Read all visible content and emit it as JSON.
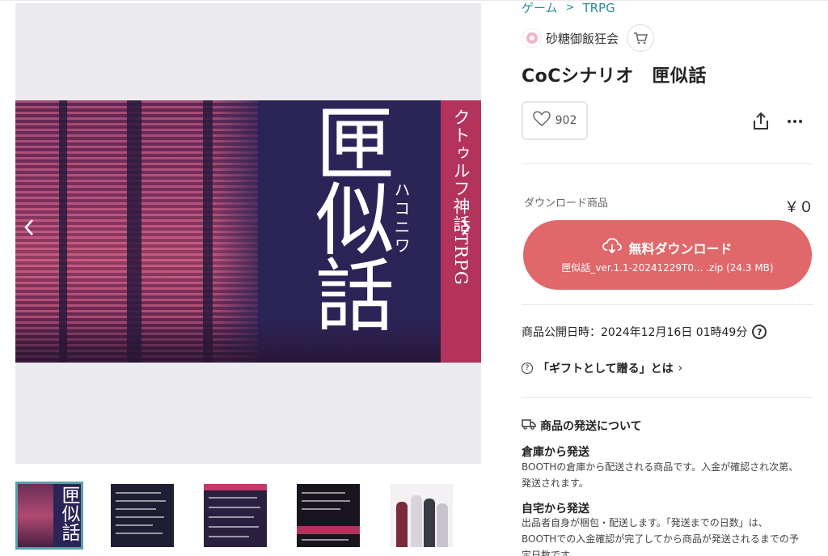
{
  "breadcrumb": {
    "items": [
      "ゲーム",
      "TRPG"
    ],
    "separator": ">"
  },
  "shop": {
    "name": "砂糖御飯狂会"
  },
  "product": {
    "title": "CoCシナリオ　匣似話",
    "likes": "902",
    "type_label": "ダウンロード商品",
    "price": "￥０"
  },
  "cover": {
    "band_text": "クトゥルフ神話TRPG",
    "title_text": "匣似話",
    "ruby_text": "ハコニワ"
  },
  "download": {
    "label": "無料ダウンロード",
    "file": "匣似話_ver.1.1-20241229T0... .zip (24.3 MB)"
  },
  "publish": {
    "text": "商品公開日時：2024年12月16日 01時49分",
    "help": "?"
  },
  "gift": {
    "label": "「ギフトとして贈る」とは",
    "chevron": "›",
    "icon": "?"
  },
  "shipping": {
    "heading": "商品の発送について",
    "warehouse_title": "倉庫から発送",
    "warehouse_body_1": "BOOTHの倉庫から配送される商品です。入金が確認され次第、",
    "warehouse_body_2": "発送されます。",
    "home_title": "自宅から発送",
    "home_body_1": "出品者自身が梱包・配送します。「発送までの日数」は、",
    "home_body_2": "BOOTHでの入金確認が完了してから商品が発送されるまでの予",
    "home_body_3": "定日数です。"
  },
  "thumbnails": {
    "first_text": "匣似話"
  },
  "colors": {
    "accent": "#e0676a",
    "link": "#2a8aa0",
    "cover_band": "#b3335c",
    "cover_dark": "#2b2456"
  },
  "icons": [
    "cart-icon",
    "heart-icon",
    "share-icon",
    "more-icon",
    "cloud-download-icon",
    "help-icon",
    "truck-icon",
    "chevron-left-icon",
    "chevron-right-icon"
  ]
}
